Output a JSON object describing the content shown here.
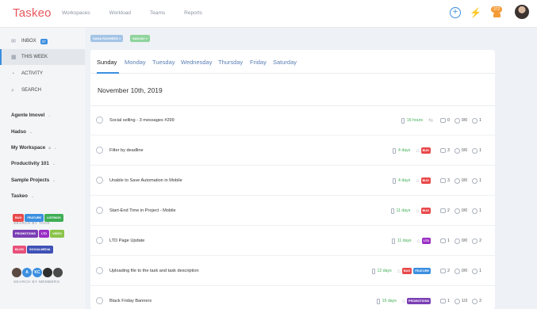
{
  "app": {
    "logo": "Taskeo"
  },
  "nav": [
    "Workspaces",
    "Workload",
    "Teams",
    "Reports"
  ],
  "notifications": {
    "count": "372"
  },
  "colors": {
    "accent": "#3b8fe0",
    "brand": "#e8585e",
    "green": "#3fae54",
    "bug": "#e8494a",
    "feature": "#3b8fe0",
    "listings": "#3fae54",
    "promotions": "#7b3fb4",
    "ltd": "#9b2fc4",
    "video": "#8bc34a",
    "blog": "#e8507a",
    "socialmedia": "#3f51b5"
  },
  "sidebar": {
    "inbox": {
      "label": "INBOX",
      "badge": "37"
    },
    "this_week": "THIS WEEK",
    "activity": "ACTIVITY",
    "search": "SEARCH",
    "projects": [
      "Agente Imovel",
      "Hadso",
      "My Workspace",
      "Productivity 101",
      "Sample Projects",
      "Taskeo"
    ],
    "search_by_tags": "SEARCH BY TAGS",
    "tags": [
      {
        "label": "BUG",
        "color": "#e8494a"
      },
      {
        "label": "FEATURE",
        "color": "#3b8fe0"
      },
      {
        "label": "LISTINGS",
        "color": "#3fae54"
      },
      {
        "label": "PROMOTIONS",
        "color": "#7b3fb4"
      },
      {
        "label": "LTD",
        "color": "#9b2fc4"
      },
      {
        "label": "VIDEO",
        "color": "#8bc34a"
      },
      {
        "label": "BLOG",
        "color": "#e8507a"
      },
      {
        "label": "SOCIALMEDIA",
        "color": "#3f51b5"
      }
    ],
    "search_by_members": "SEARCH BY MEMBERS",
    "members": [
      {
        "initials": "",
        "color": "#5a4a42"
      },
      {
        "initials": "A",
        "color": "#3b8fe0"
      },
      {
        "initials": "KC",
        "color": "#3b8fe0"
      },
      {
        "initials": "",
        "color": "#2f2f2f"
      },
      {
        "initials": "",
        "color": "#4a4a4a"
      }
    ]
  },
  "filters": [
    {
      "label": "SANA RASHEED ×",
      "color": "#a3c4e6"
    },
    {
      "label": "SANJAY ×",
      "color": "#8fd49c"
    }
  ],
  "tabs": [
    "Sunday",
    "Monday",
    "Tuesday",
    "Wednesday",
    "Thursday",
    "Friday",
    "Saturday"
  ],
  "date": "November 10th, 2019",
  "tasks": [
    {
      "title": "Social selling - 3 messages #299",
      "due": "16 hours",
      "tags": [],
      "link": true,
      "comments": "0",
      "subtasks": "0/0",
      "members": "1"
    },
    {
      "title": "Filter by deadline",
      "due": "4 days",
      "tags": [
        {
          "label": "BUG",
          "color": "#e8494a"
        }
      ],
      "comments": "3",
      "subtasks": "0/0",
      "members": "1"
    },
    {
      "title": "Unable to Save Automation in Mobile",
      "due": "4 days",
      "tags": [
        {
          "label": "BUG",
          "color": "#e8494a"
        }
      ],
      "comments": "3",
      "subtasks": "0/0",
      "members": "1"
    },
    {
      "title": "Start-End Time in Project - Mobile",
      "due": "11 days",
      "tags": [
        {
          "label": "BUG",
          "color": "#e8494a"
        }
      ],
      "comments": "2",
      "subtasks": "0/0",
      "members": "1"
    },
    {
      "title": "LTD Page Update",
      "due": "11 days",
      "tags": [
        {
          "label": "LTD",
          "color": "#9b2fc4"
        }
      ],
      "comments": "1",
      "subtasks": "0/0",
      "members": "2"
    },
    {
      "title": "Uploading file to the task and task description",
      "due": "12 days",
      "tags": [
        {
          "label": "BUG",
          "color": "#e8494a"
        },
        {
          "label": "FEATURE",
          "color": "#3b8fe0"
        }
      ],
      "comments": "2",
      "subtasks": "0/0",
      "members": "1"
    },
    {
      "title": "Black Friday Banners",
      "due": "15 days",
      "tags": [
        {
          "label": "PROMOTIONS",
          "color": "#7b3fb4"
        }
      ],
      "comments": "1",
      "subtasks": "1/3",
      "members": "2"
    }
  ]
}
